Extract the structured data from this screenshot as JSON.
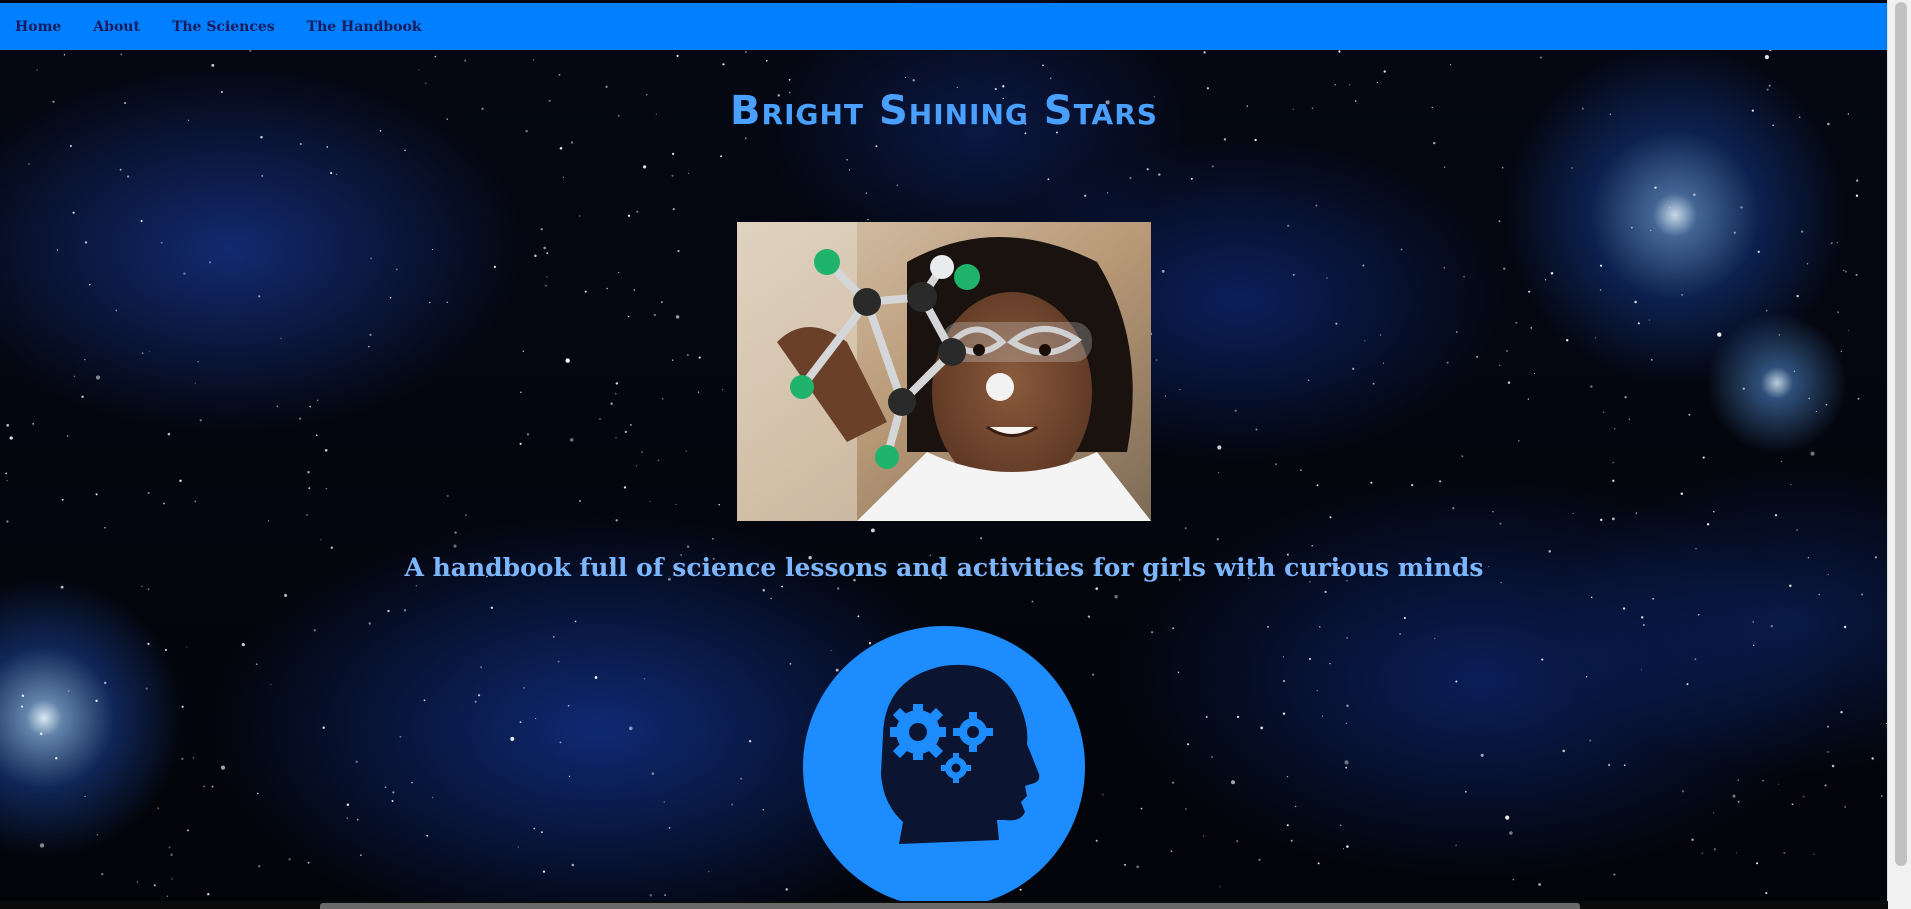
{
  "nav": {
    "items": [
      {
        "label": "Home"
      },
      {
        "label": "About"
      },
      {
        "label": "The Sciences"
      },
      {
        "label": "The Handbook"
      }
    ]
  },
  "hero": {
    "title": "Bright Shining Stars",
    "image_icon": "girl-with-molecule-model-photo",
    "tagline": "A handbook full of science lessons and activities for girls with curious minds"
  },
  "logo": {
    "icon": "head-with-gears-icon"
  },
  "colors": {
    "navbar": "#0080ff",
    "nav_text": "#1a1a5e",
    "title": "#4aa0ff",
    "tagline": "#7cb6ff",
    "logo_circle": "#1d8cff",
    "logo_head": "#0b1430"
  }
}
